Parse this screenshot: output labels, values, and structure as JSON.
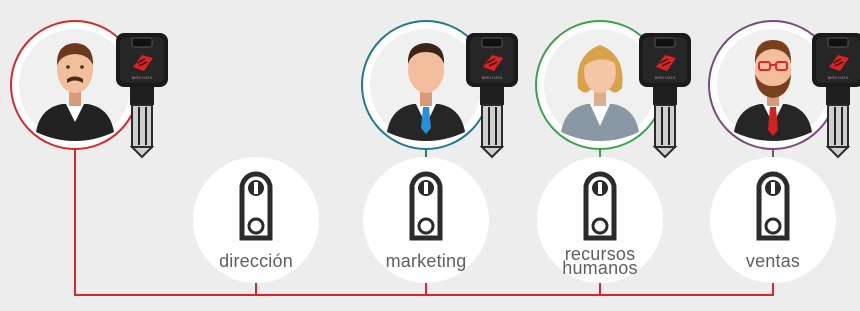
{
  "colors": {
    "background": "#ededed",
    "line": "#d62828",
    "marketing": "#1f7a8c",
    "recursos_humanos": "#3aa34a",
    "ventas": "#7a4a7a"
  },
  "departments": [
    {
      "label": "dirección"
    },
    {
      "label": "marketing"
    },
    {
      "label": "recursos",
      "label2": "humanos"
    },
    {
      "label": "ventas"
    }
  ],
  "people": [
    {
      "role": "director",
      "icon": "man-mustache-avatar"
    },
    {
      "role": "marketing",
      "icon": "businessman-blue-tie-avatar"
    },
    {
      "role": "recursos-humanos",
      "icon": "businesswoman-avatar"
    },
    {
      "role": "ventas",
      "icon": "man-beard-glasses-avatar"
    }
  ],
  "key_icon": "key-icon",
  "lock_icon": "lock-cylinder-icon"
}
